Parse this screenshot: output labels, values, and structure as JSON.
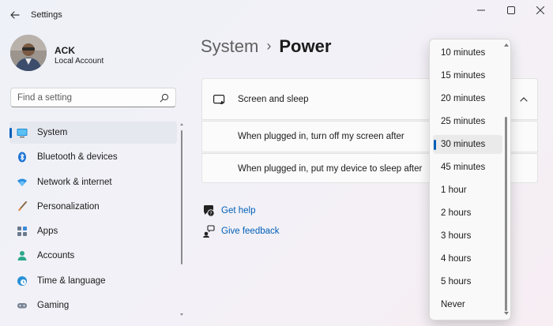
{
  "window": {
    "title": "Settings",
    "minimize_icon": "minimize-icon",
    "maximize_icon": "maximize-icon",
    "close_icon": "close-icon"
  },
  "profile": {
    "name": "ACK",
    "account_type": "Local Account"
  },
  "search": {
    "placeholder": "Find a setting"
  },
  "sidebar": {
    "items": [
      {
        "label": "System",
        "icon": "system-icon",
        "active": true
      },
      {
        "label": "Bluetooth & devices",
        "icon": "bluetooth-icon"
      },
      {
        "label": "Network & internet",
        "icon": "wifi-icon"
      },
      {
        "label": "Personalization",
        "icon": "brush-icon"
      },
      {
        "label": "Apps",
        "icon": "apps-icon"
      },
      {
        "label": "Accounts",
        "icon": "accounts-icon"
      },
      {
        "label": "Time & language",
        "icon": "globe-clock-icon"
      },
      {
        "label": "Gaming",
        "icon": "gamepad-icon"
      }
    ]
  },
  "breadcrumb": {
    "parent": "System",
    "separator": "›",
    "current": "Power"
  },
  "screen_sleep": {
    "title": "Screen and sleep",
    "expanded": true,
    "rows": [
      {
        "label": "When plugged in, turn off my screen after"
      },
      {
        "label": "When plugged in, put my device to sleep after"
      }
    ]
  },
  "links": {
    "help": "Get help",
    "feedback": "Give feedback"
  },
  "dropdown": {
    "options": [
      "10 minutes",
      "15 minutes",
      "20 minutes",
      "25 minutes",
      "30 minutes",
      "45 minutes",
      "1 hour",
      "2 hours",
      "3 hours",
      "4 hours",
      "5 hours",
      "Never"
    ],
    "selected": "30 minutes"
  },
  "colors": {
    "accent": "#005fb8",
    "background": "#f3f1f7"
  }
}
